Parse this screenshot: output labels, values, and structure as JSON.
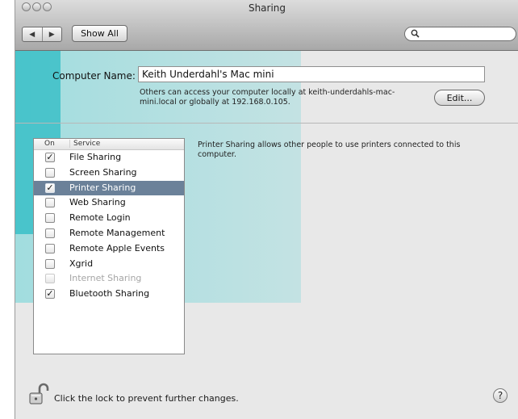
{
  "window": {
    "title": "Sharing"
  },
  "toolbar": {
    "back_icon": "◀",
    "forward_icon": "▶",
    "show_all_label": "Show All",
    "search_placeholder": ""
  },
  "computer_name": {
    "label": "Computer Name:",
    "value": "Keith Underdahl's Mac mini",
    "help_text": "Others can access your computer locally at keith-underdahls-mac-mini.local or globally at 192.168.0.105.",
    "edit_label": "Edit..."
  },
  "services": {
    "header_on": "On",
    "header_service": "Service",
    "items": [
      {
        "label": "File Sharing",
        "checked": true,
        "check": "✓"
      },
      {
        "label": "Screen Sharing",
        "checked": false,
        "check": ""
      },
      {
        "label": "Printer Sharing",
        "checked": true,
        "check": "✓",
        "selected": true
      },
      {
        "label": "Web Sharing",
        "checked": false,
        "check": ""
      },
      {
        "label": "Remote Login",
        "checked": false,
        "check": ""
      },
      {
        "label": "Remote Management",
        "checked": false,
        "check": ""
      },
      {
        "label": "Remote Apple Events",
        "checked": false,
        "check": ""
      },
      {
        "label": "Xgrid",
        "checked": false,
        "check": ""
      },
      {
        "label": "Internet Sharing",
        "checked": false,
        "check": "",
        "disabled": true
      },
      {
        "label": "Bluetooth Sharing",
        "checked": true,
        "check": "✓"
      }
    ]
  },
  "description": "Printer Sharing allows other people to use printers connected to this computer.",
  "footer": {
    "lock_text": "Click the lock to prevent further changes.",
    "help_label": "?"
  },
  "colors": {
    "selection": "#6b8199",
    "accent_overlay": "#1ec8cd"
  }
}
